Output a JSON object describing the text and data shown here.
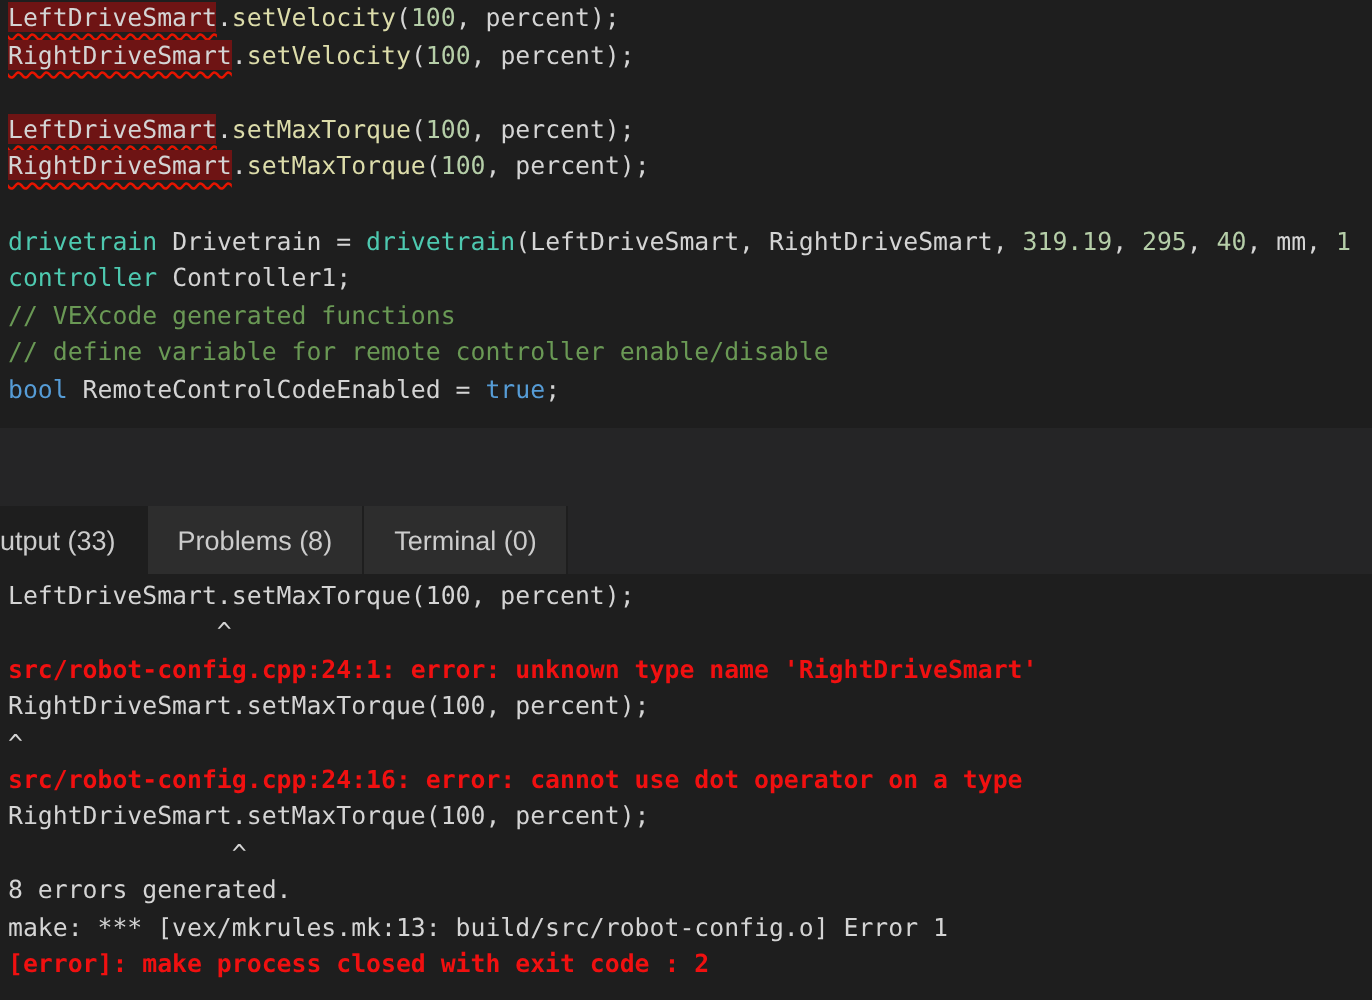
{
  "editor": {
    "lines": [
      {
        "kind": "code",
        "tokens": [
          {
            "kind": "error",
            "text": "LeftDriveSmart"
          },
          {
            "kind": "plain",
            "text": "."
          },
          {
            "kind": "func",
            "text": "setVelocity"
          },
          {
            "kind": "plain",
            "text": "("
          },
          {
            "kind": "number",
            "text": "100"
          },
          {
            "kind": "plain",
            "text": ", percent);"
          }
        ]
      },
      {
        "kind": "code",
        "tokens": [
          {
            "kind": "error",
            "text": "RightDriveSmart"
          },
          {
            "kind": "plain",
            "text": "."
          },
          {
            "kind": "func",
            "text": "setVelocity"
          },
          {
            "kind": "plain",
            "text": "("
          },
          {
            "kind": "number",
            "text": "100"
          },
          {
            "kind": "plain",
            "text": ", percent);"
          }
        ]
      },
      {
        "kind": "blank"
      },
      {
        "kind": "code",
        "tokens": [
          {
            "kind": "error",
            "text": "LeftDriveSmart"
          },
          {
            "kind": "plain",
            "text": "."
          },
          {
            "kind": "func",
            "text": "setMaxTorque"
          },
          {
            "kind": "plain",
            "text": "("
          },
          {
            "kind": "number",
            "text": "100"
          },
          {
            "kind": "plain",
            "text": ", percent);"
          }
        ]
      },
      {
        "kind": "code",
        "tokens": [
          {
            "kind": "error",
            "text": "RightDriveSmart"
          },
          {
            "kind": "plain",
            "text": "."
          },
          {
            "kind": "func",
            "text": "setMaxTorque"
          },
          {
            "kind": "plain",
            "text": "("
          },
          {
            "kind": "number",
            "text": "100"
          },
          {
            "kind": "plain",
            "text": ", percent);"
          }
        ]
      },
      {
        "kind": "blank"
      },
      {
        "kind": "code",
        "tokens": [
          {
            "kind": "type",
            "text": "drivetrain"
          },
          {
            "kind": "plain",
            "text": " Drivetrain = "
          },
          {
            "kind": "type",
            "text": "drivetrain"
          },
          {
            "kind": "plain",
            "text": "(LeftDriveSmart, RightDriveSmart, "
          },
          {
            "kind": "number",
            "text": "319.19"
          },
          {
            "kind": "plain",
            "text": ", "
          },
          {
            "kind": "number",
            "text": "295"
          },
          {
            "kind": "plain",
            "text": ", "
          },
          {
            "kind": "number",
            "text": "40"
          },
          {
            "kind": "plain",
            "text": ", mm, "
          },
          {
            "kind": "number",
            "text": "1"
          }
        ]
      },
      {
        "kind": "code",
        "tokens": [
          {
            "kind": "type",
            "text": "controller"
          },
          {
            "kind": "plain",
            "text": " Controller1;"
          }
        ]
      },
      {
        "kind": "code",
        "tokens": [
          {
            "kind": "comment",
            "text": "// VEXcode generated functions"
          }
        ]
      },
      {
        "kind": "code",
        "tokens": [
          {
            "kind": "comment",
            "text": "// define variable for remote controller enable/disable"
          }
        ]
      },
      {
        "kind": "code",
        "tokens": [
          {
            "kind": "keyword",
            "text": "bool"
          },
          {
            "kind": "plain",
            "text": " RemoteControlCodeEnabled = "
          },
          {
            "kind": "keyword",
            "text": "true"
          },
          {
            "kind": "plain",
            "text": ";"
          }
        ]
      }
    ]
  },
  "panel": {
    "tabs": [
      {
        "label": "utput (33)",
        "selected": true
      },
      {
        "label": "Problems (8)",
        "selected": false
      },
      {
        "label": "Terminal (0)",
        "selected": false
      }
    ],
    "output": [
      {
        "kind": "plain",
        "text": "LeftDriveSmart.setMaxTorque(100, percent);"
      },
      {
        "kind": "plain",
        "text": "              ^"
      },
      {
        "kind": "error",
        "text": "src/robot-config.cpp:24:1: error: unknown type name 'RightDriveSmart'"
      },
      {
        "kind": "plain",
        "text": "RightDriveSmart.setMaxTorque(100, percent);"
      },
      {
        "kind": "plain",
        "text": "^"
      },
      {
        "kind": "error",
        "text": "src/robot-config.cpp:24:16: error: cannot use dot operator on a type"
      },
      {
        "kind": "plain",
        "text": "RightDriveSmart.setMaxTorque(100, percent);"
      },
      {
        "kind": "plain",
        "text": "               ^"
      },
      {
        "kind": "plain",
        "text": "8 errors generated."
      },
      {
        "kind": "plain",
        "text": "make: *** [vex/mkrules.mk:13: build/src/robot-config.o] Error 1"
      },
      {
        "kind": "error",
        "text": "[error]: make process closed with exit code : 2"
      }
    ]
  }
}
